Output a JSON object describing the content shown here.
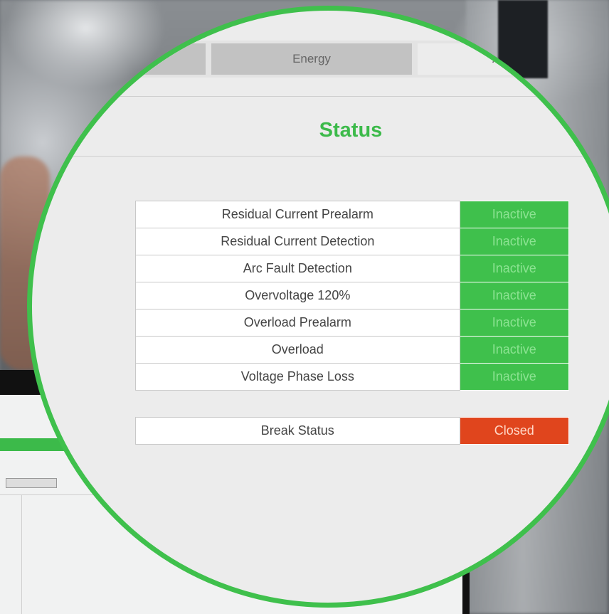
{
  "tabs": [
    {
      "label": ""
    },
    {
      "label": "Energy"
    },
    {
      "label": "A"
    }
  ],
  "section_title": "Status",
  "status_rows": [
    {
      "name": "Residual Current Prealarm",
      "value": "Inactive"
    },
    {
      "name": "Residual Current Detection",
      "value": "Inactive"
    },
    {
      "name": "Arc Fault Detection",
      "value": "Inactive"
    },
    {
      "name": "Overvoltage 120%",
      "value": "Inactive"
    },
    {
      "name": "Overload Prealarm",
      "value": "Inactive"
    },
    {
      "name": "Overload",
      "value": "Inactive"
    },
    {
      "name": "Voltage Phase Loss",
      "value": "Inactive"
    }
  ],
  "break_status": {
    "name": "Break Status",
    "value": "Closed"
  },
  "colors": {
    "accent_green": "#3fc04c",
    "inactive_green": "#3fc04c",
    "closed_red": "#e0451d"
  }
}
